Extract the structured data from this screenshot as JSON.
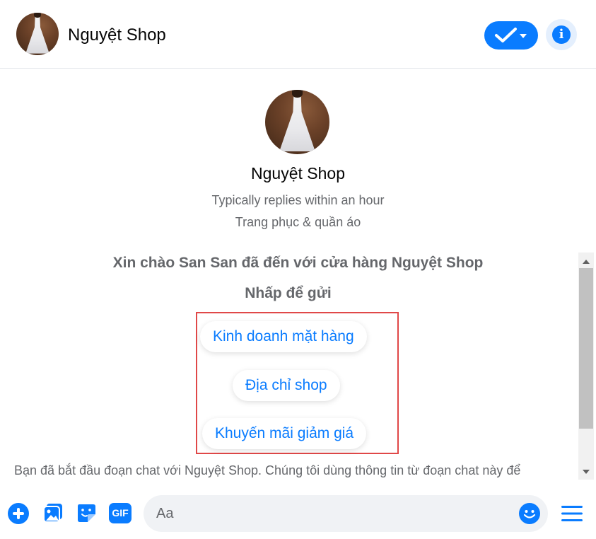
{
  "header": {
    "title": "Nguyệt Shop"
  },
  "profile": {
    "name": "Nguyệt Shop",
    "response_time": "Typically replies within an hour",
    "category": "Trang phục & quần áo"
  },
  "chat": {
    "greeting": "Xin chào San San đã đến với cửa hàng Nguyệt Shop",
    "prompt": "Nhấp để gửi",
    "quick_replies": [
      {
        "label": "Kinh doanh mặt hàng"
      },
      {
        "label": "Địa chỉ shop"
      },
      {
        "label": "Khuyến mãi giảm giá"
      }
    ],
    "notice": "Bạn đã bắt đầu đoạn chat với Nguyệt Shop. Chúng tôi dùng thông tin từ đoạn chat này để"
  },
  "composer": {
    "placeholder": "Aa",
    "gif_label": "GIF"
  },
  "colors": {
    "accent": "#0a7cff",
    "highlight_border": "#e04848",
    "secondary_text": "#65676b"
  },
  "icons": [
    "shop-avatar",
    "check-dropdown-icon",
    "info-icon",
    "plus-icon",
    "photo-icon",
    "sticker-icon",
    "gif-icon",
    "emoji-icon",
    "menu-icon"
  ]
}
